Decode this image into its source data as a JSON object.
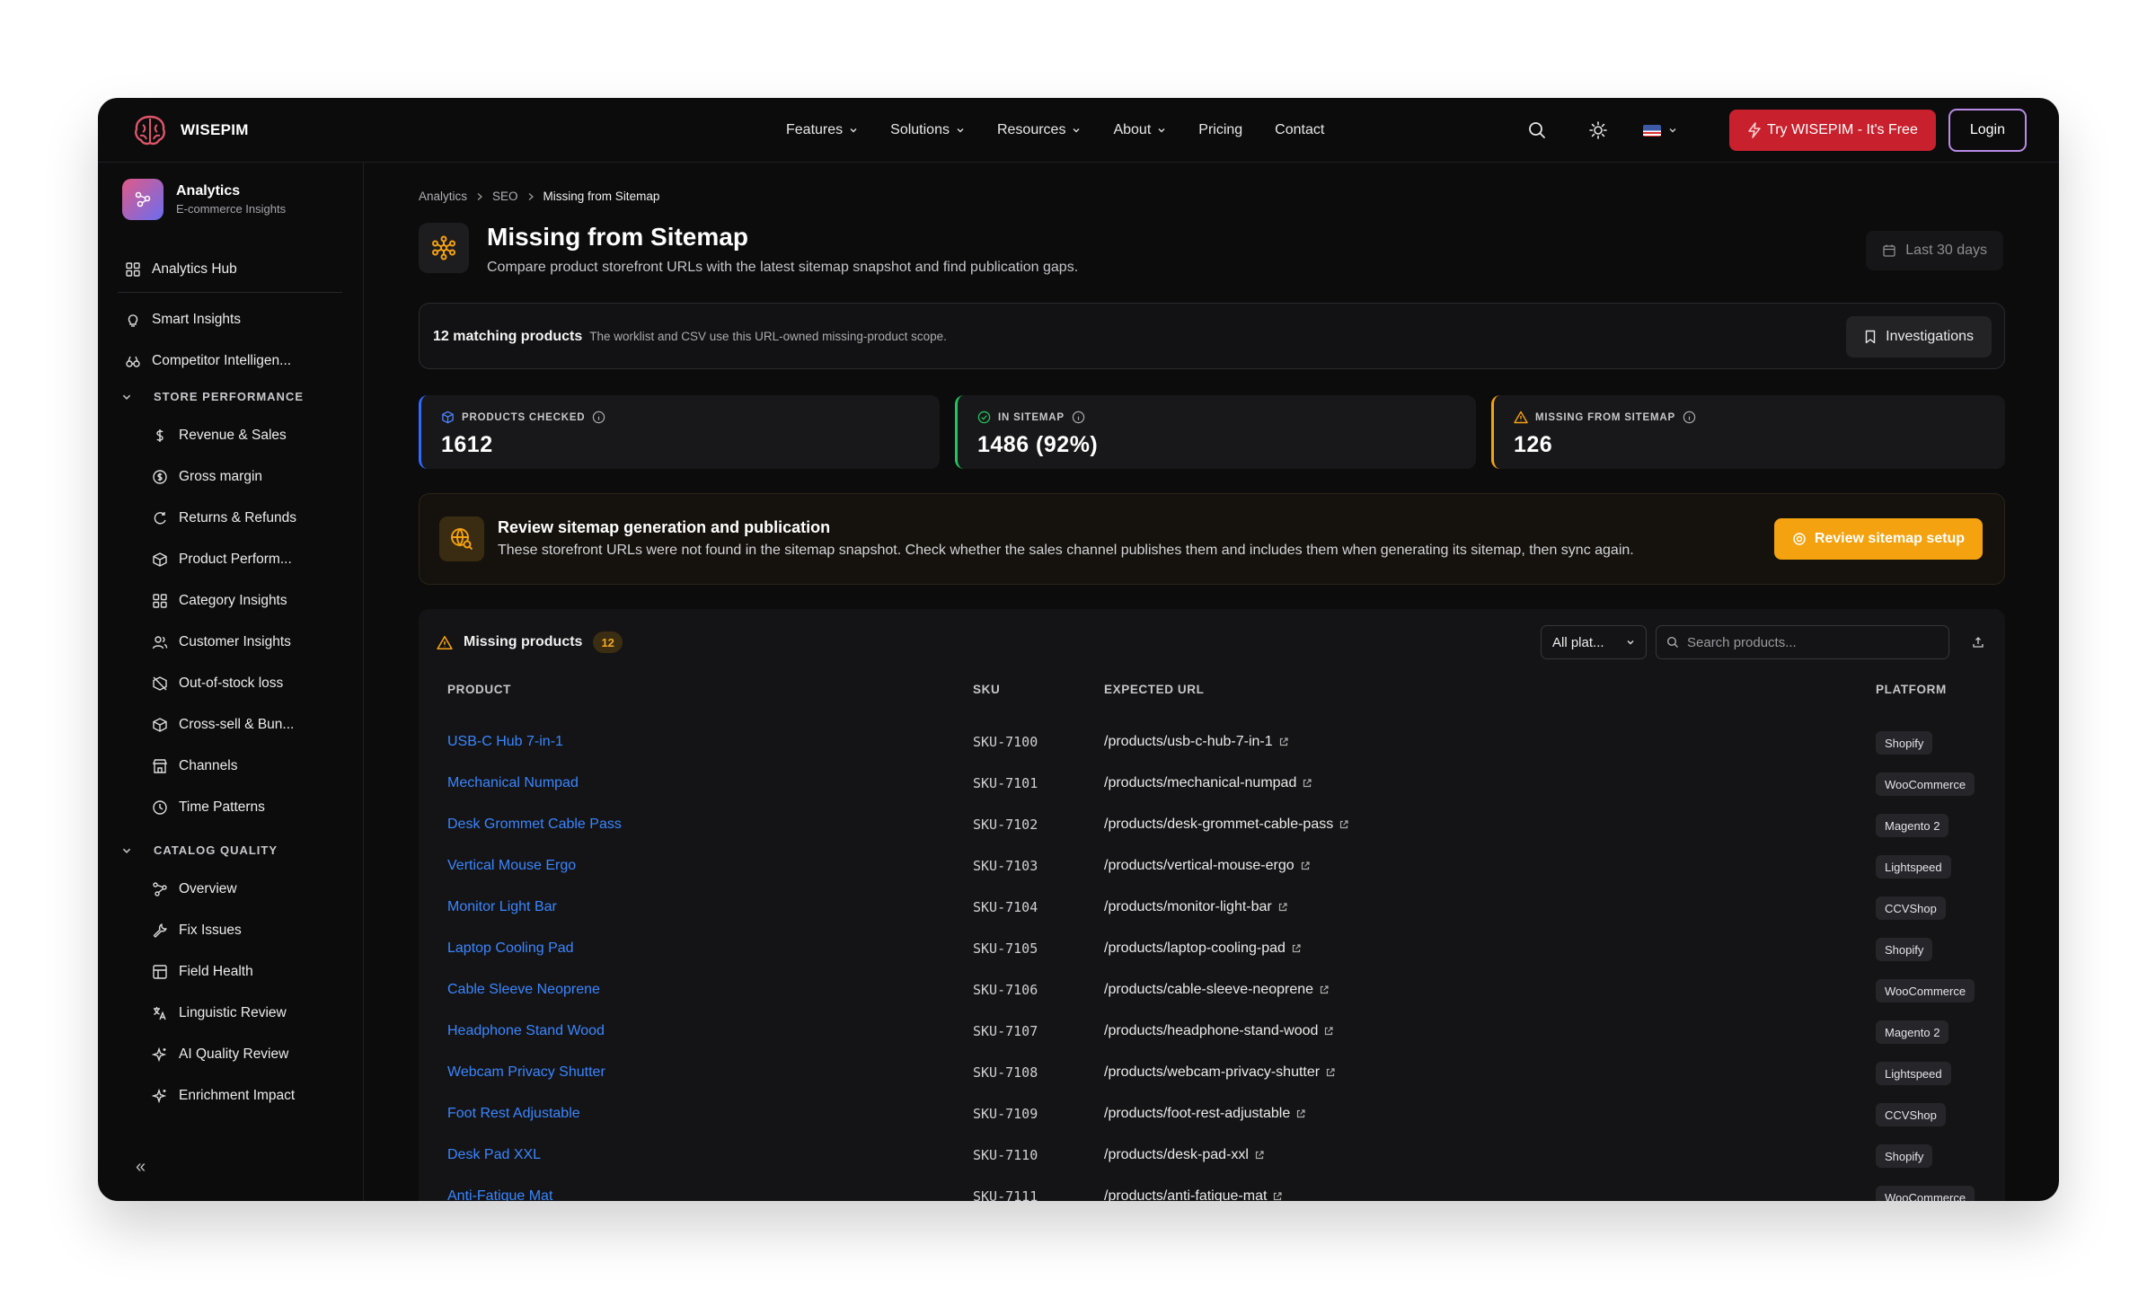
{
  "brand": {
    "name": "WISEPIM"
  },
  "nav": {
    "items": [
      {
        "label": "Features",
        "dropdown": true
      },
      {
        "label": "Solutions",
        "dropdown": true
      },
      {
        "label": "Resources",
        "dropdown": true
      },
      {
        "label": "About",
        "dropdown": true
      },
      {
        "label": "Pricing",
        "dropdown": false
      },
      {
        "label": "Contact",
        "dropdown": false
      }
    ],
    "try_label": "Try WISEPIM - It's Free",
    "login_label": "Login"
  },
  "sidebar": {
    "app_title": "Analytics",
    "app_subtitle": "E-commerce Insights",
    "hub": "Analytics Hub",
    "top_items": [
      "Smart Insights",
      "Competitor Intelligen..."
    ],
    "section_store": "STORE PERFORMANCE",
    "store_items": [
      "Revenue & Sales",
      "Gross margin",
      "Returns & Refunds",
      "Product Perform...",
      "Category Insights",
      "Customer Insights",
      "Out-of-stock loss",
      "Cross-sell & Bun...",
      "Channels",
      "Time Patterns"
    ],
    "section_catalog": "CATALOG QUALITY",
    "catalog_items": [
      "Overview",
      "Fix Issues",
      "Field Health",
      "Linguistic Review",
      "AI Quality Review",
      "Enrichment Impact"
    ],
    "collapse": "«"
  },
  "breadcrumb": [
    "Analytics",
    "SEO",
    "Missing from Sitemap"
  ],
  "page": {
    "title": "Missing from Sitemap",
    "subtitle": "Compare product storefront URLs with the latest sitemap snapshot and find publication gaps.",
    "range": "Last 30 days"
  },
  "scope": {
    "count_label": "12 matching products",
    "note": "The worklist and CSV use this URL-owned missing-product scope.",
    "investigations": "Investigations"
  },
  "kpis": [
    {
      "label": "PRODUCTS CHECKED",
      "value": "1612",
      "color": "#2f6bff"
    },
    {
      "label": "IN SITEMAP",
      "value": "1486 (92%)",
      "color": "#22c55e"
    },
    {
      "label": "MISSING FROM SITEMAP",
      "value": "126",
      "color": "#f5a20f"
    }
  ],
  "alert": {
    "title": "Review sitemap generation and publication",
    "text": "These storefront URLs were not found in the sitemap snapshot. Check whether the sales channel publishes them and includes them when generating its sitemap, then sync again.",
    "button": "Review sitemap setup"
  },
  "table": {
    "title": "Missing products",
    "count": "12",
    "filter": "All plat...",
    "search_placeholder": "Search products...",
    "headers": [
      "PRODUCT",
      "SKU",
      "EXPECTED URL",
      "PLATFORM"
    ],
    "rows": [
      {
        "product": "USB-C Hub 7-in-1",
        "sku": "SKU-7100",
        "url": "/products/usb-c-hub-7-in-1",
        "platform": "Shopify"
      },
      {
        "product": "Mechanical Numpad",
        "sku": "SKU-7101",
        "url": "/products/mechanical-numpad",
        "platform": "WooCommerce"
      },
      {
        "product": "Desk Grommet Cable Pass",
        "sku": "SKU-7102",
        "url": "/products/desk-grommet-cable-pass",
        "platform": "Magento 2"
      },
      {
        "product": "Vertical Mouse Ergo",
        "sku": "SKU-7103",
        "url": "/products/vertical-mouse-ergo",
        "platform": "Lightspeed"
      },
      {
        "product": "Monitor Light Bar",
        "sku": "SKU-7104",
        "url": "/products/monitor-light-bar",
        "platform": "CCVShop"
      },
      {
        "product": "Laptop Cooling Pad",
        "sku": "SKU-7105",
        "url": "/products/laptop-cooling-pad",
        "platform": "Shopify"
      },
      {
        "product": "Cable Sleeve Neoprene",
        "sku": "SKU-7106",
        "url": "/products/cable-sleeve-neoprene",
        "platform": "WooCommerce"
      },
      {
        "product": "Headphone Stand Wood",
        "sku": "SKU-7107",
        "url": "/products/headphone-stand-wood",
        "platform": "Magento 2"
      },
      {
        "product": "Webcam Privacy Shutter",
        "sku": "SKU-7108",
        "url": "/products/webcam-privacy-shutter",
        "platform": "Lightspeed"
      },
      {
        "product": "Foot Rest Adjustable",
        "sku": "SKU-7109",
        "url": "/products/foot-rest-adjustable",
        "platform": "CCVShop"
      },
      {
        "product": "Desk Pad XXL",
        "sku": "SKU-7110",
        "url": "/products/desk-pad-xxl",
        "platform": "Shopify"
      },
      {
        "product": "Anti-Fatigue Mat",
        "sku": "SKU-7111",
        "url": "/products/anti-fatigue-mat",
        "platform": "WooCommerce"
      }
    ]
  }
}
